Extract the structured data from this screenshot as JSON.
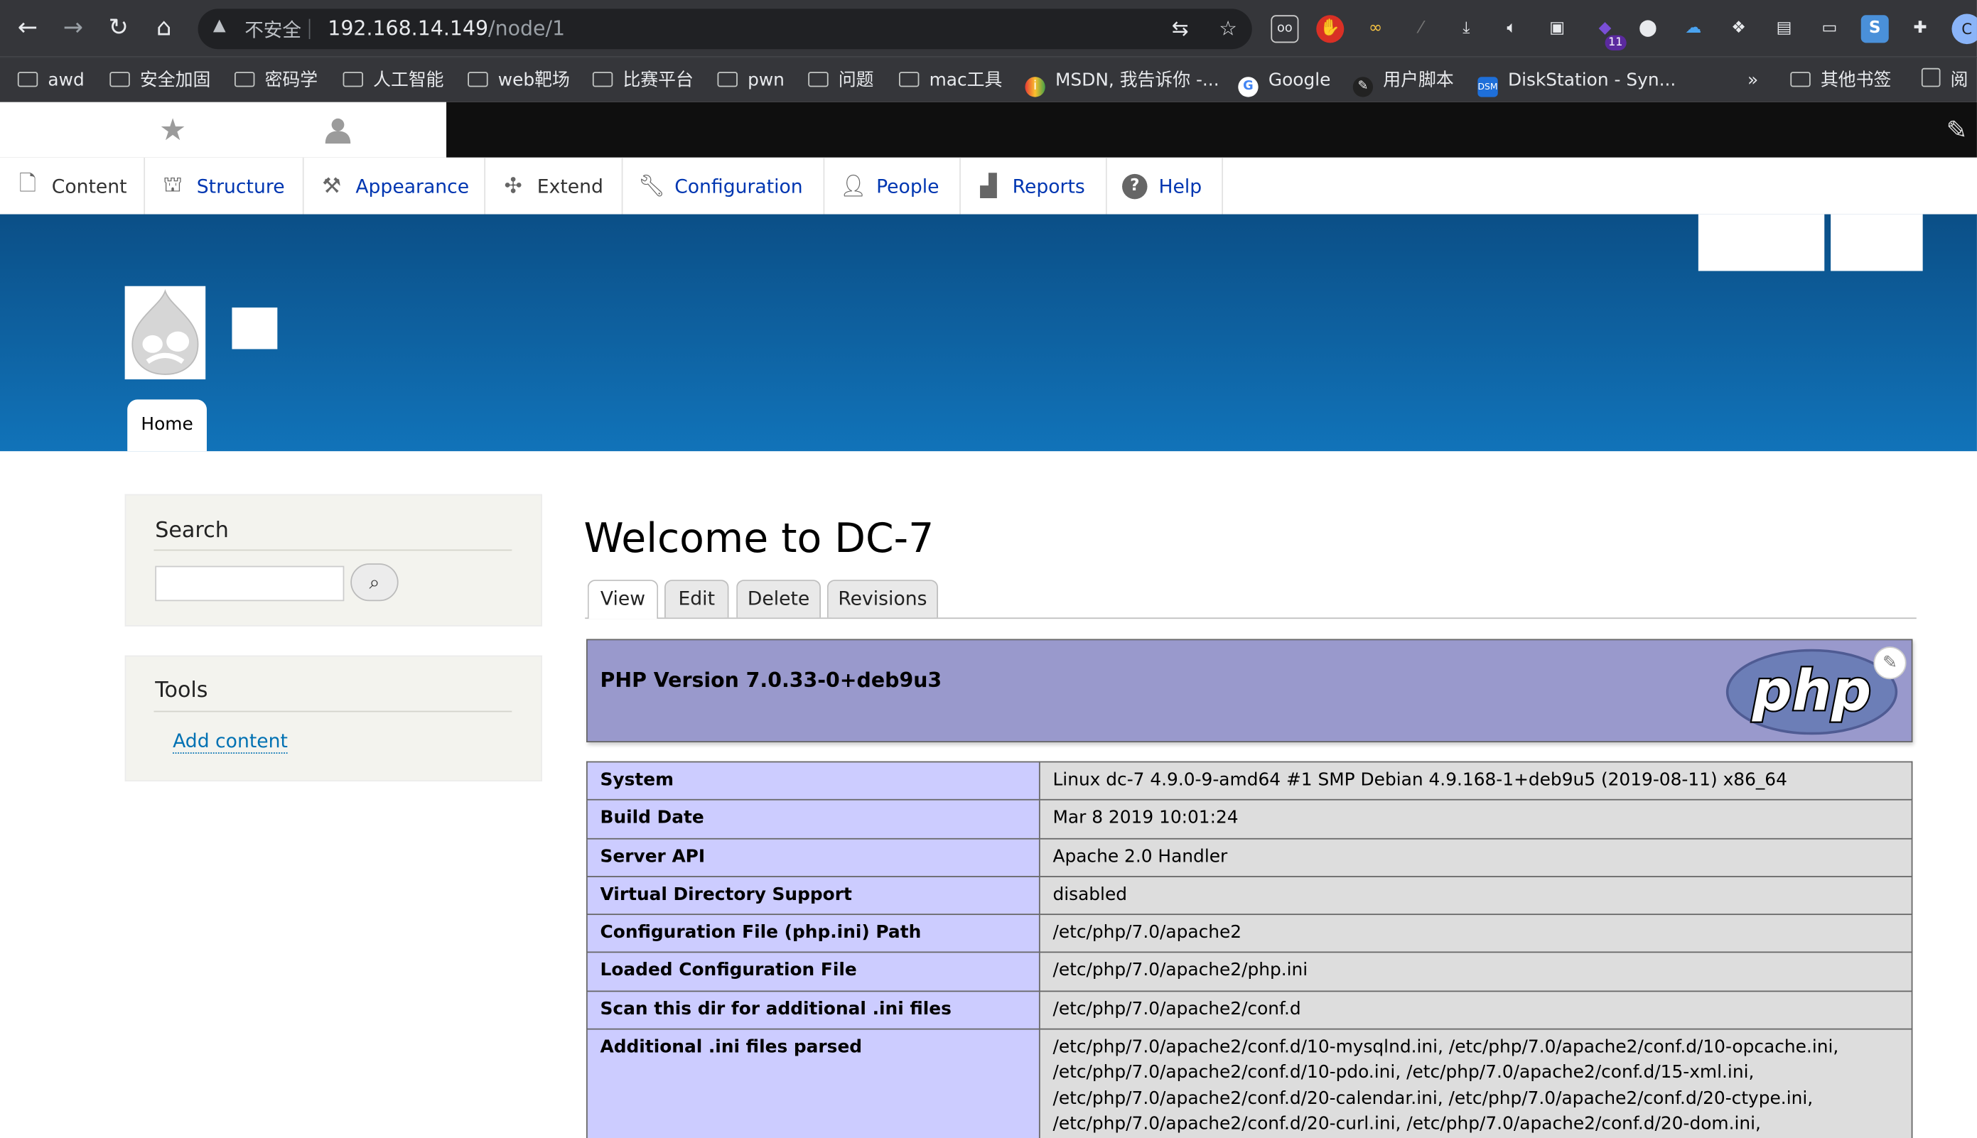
{
  "browser": {
    "insecure_label": "不安全",
    "url_host": "192.168.14.149",
    "url_path": "/node/1",
    "extension_badge": "11",
    "profile_initial": "C"
  },
  "bookmarks": [
    {
      "label": "awd",
      "icon": "folder-icon"
    },
    {
      "label": "安全加固",
      "icon": "folder-icon"
    },
    {
      "label": "密码学",
      "icon": "folder-icon"
    },
    {
      "label": "人工智能",
      "icon": "folder-icon"
    },
    {
      "label": "web靶场",
      "icon": "folder-icon"
    },
    {
      "label": "比赛平台",
      "icon": "folder-icon"
    },
    {
      "label": "pwn",
      "icon": "folder-icon"
    },
    {
      "label": "问题",
      "icon": "folder-icon"
    },
    {
      "label": "mac工具",
      "icon": "folder-icon"
    },
    {
      "label": "MSDN, 我告诉你 -...",
      "icon": "msdn-icon"
    },
    {
      "label": "Google",
      "icon": "google-icon"
    },
    {
      "label": "用户脚本",
      "icon": "script-icon"
    },
    {
      "label": "DiskStation - Syn...",
      "icon": "dsm-icon"
    }
  ],
  "bookmarks_overflow": "»",
  "bookmarks_other": "其他书签",
  "bookmarks_reading": "阅",
  "admin_menu": [
    {
      "label": "Content",
      "icon": "file-icon"
    },
    {
      "label": "Structure",
      "icon": "sitemap-icon"
    },
    {
      "label": "Appearance",
      "icon": "brush-icon"
    },
    {
      "label": "Extend",
      "icon": "puzzle-icon"
    },
    {
      "label": "Configuration",
      "icon": "wrench-icon"
    },
    {
      "label": "People",
      "icon": "people-icon"
    },
    {
      "label": "Reports",
      "icon": "bar-chart-icon"
    },
    {
      "label": "Help",
      "icon": "help-icon"
    }
  ],
  "site": {
    "home_tab": "Home"
  },
  "sidebar": {
    "search_title": "Search",
    "tools_title": "Tools",
    "add_content": "Add content"
  },
  "page": {
    "title": "Welcome to DC-7",
    "tabs": [
      "View",
      "Edit",
      "Delete",
      "Revisions"
    ]
  },
  "phpinfo": {
    "version": "PHP Version 7.0.33-0+deb9u3",
    "rows": [
      {
        "key": "System",
        "value": "Linux dc-7 4.9.0-9-amd64 #1 SMP Debian 4.9.168-1+deb9u5 (2019-08-11) x86_64"
      },
      {
        "key": "Build Date",
        "value": "Mar 8 2019 10:01:24"
      },
      {
        "key": "Server API",
        "value": "Apache 2.0 Handler"
      },
      {
        "key": "Virtual Directory Support",
        "value": "disabled"
      },
      {
        "key": "Configuration File (php.ini) Path",
        "value": "/etc/php/7.0/apache2"
      },
      {
        "key": "Loaded Configuration File",
        "value": "/etc/php/7.0/apache2/php.ini"
      },
      {
        "key": "Scan this dir for additional .ini files",
        "value": "/etc/php/7.0/apache2/conf.d"
      },
      {
        "key": "Additional .ini files parsed",
        "value": "/etc/php/7.0/apache2/conf.d/10-mysqlnd.ini, /etc/php/7.0/apache2/conf.d/10-opcache.ini, /etc/php/7.0/apache2/conf.d/10-pdo.ini, /etc/php/7.0/apache2/conf.d/15-xml.ini, /etc/php/7.0/apache2/conf.d/20-calendar.ini, /etc/php/7.0/apache2/conf.d/20-ctype.ini, /etc/php/7.0/apache2/conf.d/20-curl.ini, /etc/php/7.0/apache2/conf.d/20-dom.ini,"
      }
    ]
  },
  "colors": {
    "header_top": "#0b4f87",
    "header_bottom": "#1173b9",
    "php_header": "#9999cc",
    "php_key": "#ccccff",
    "php_value": "#dddddd",
    "link": "#0071b3"
  }
}
